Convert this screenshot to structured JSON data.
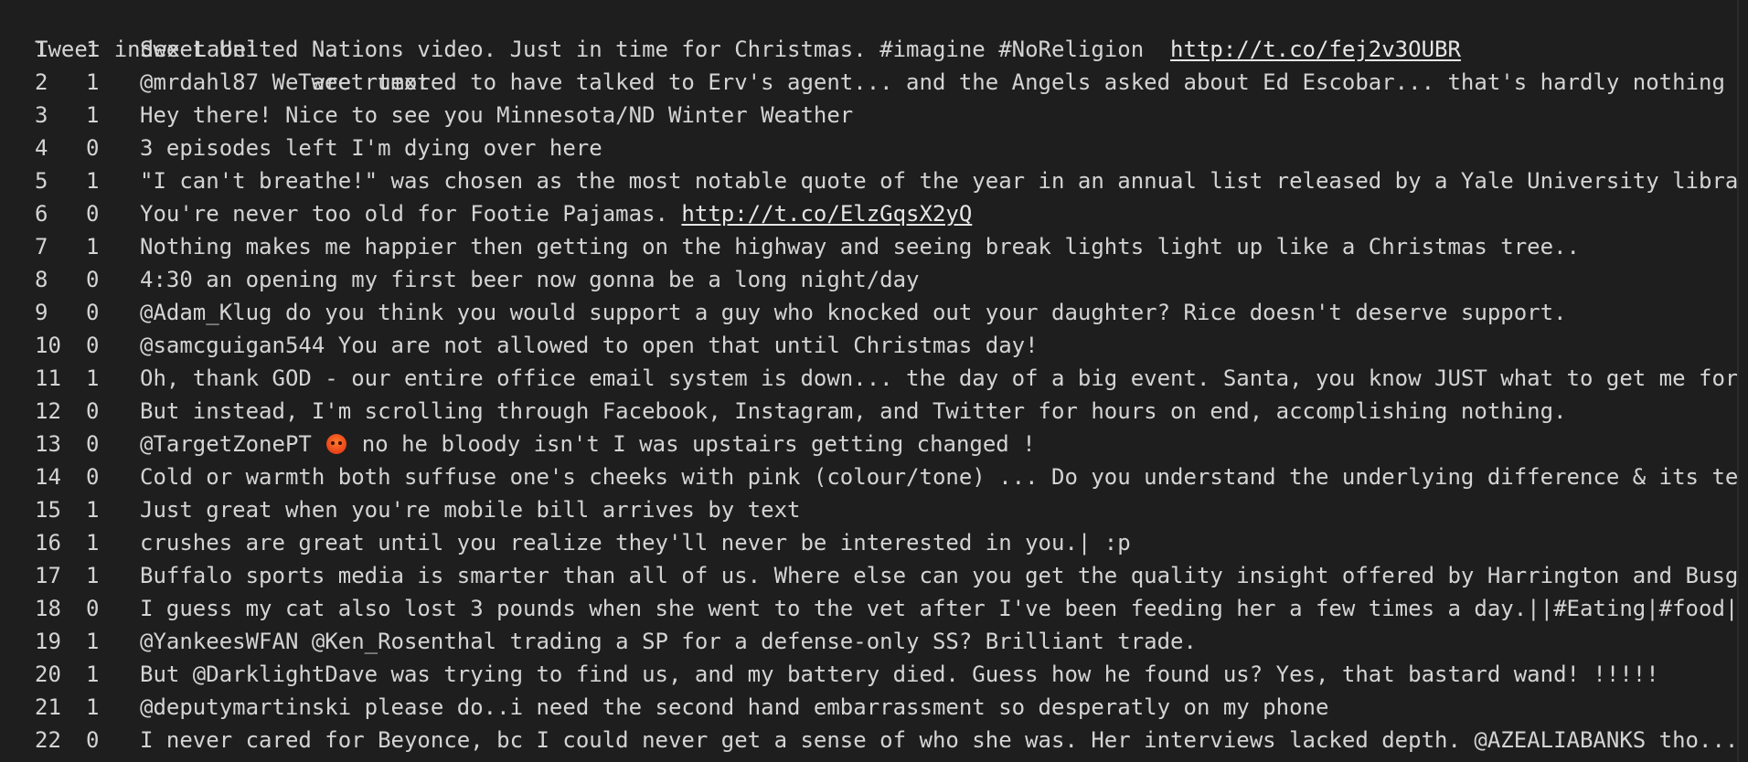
{
  "header": {
    "col1": "Tweet index Label",
    "col2": "Tweet text"
  },
  "rows": [
    {
      "index": "1",
      "label": "1",
      "text": "Sweet United Nations video. Just in time for Christmas. #imagine #NoReligion  ",
      "link": "http://t.co/fej2v3OUBR"
    },
    {
      "index": "2",
      "label": "1",
      "text": "@mrdahl87 We are rumored to have talked to Erv's agent... and the Angels asked about Ed Escobar... that's hardly nothing ;)"
    },
    {
      "index": "3",
      "label": "1",
      "text": "Hey there! Nice to see you Minnesota/ND Winter Weather"
    },
    {
      "index": "4",
      "label": "0",
      "text": "3 episodes left I'm dying over here"
    },
    {
      "index": "5",
      "label": "1",
      "text": "\"I can't breathe!\" was chosen as the most notable quote of the year in an annual list released by a Yale University librarian"
    },
    {
      "index": "6",
      "label": "0",
      "text": "You're never too old for Footie Pajamas. ",
      "link": "http://t.co/ElzGqsX2yQ"
    },
    {
      "index": "7",
      "label": "1",
      "text": "Nothing makes me happier then getting on the highway and seeing break lights light up like a Christmas tree.."
    },
    {
      "index": "8",
      "label": "0",
      "text": "4:30 an opening my first beer now gonna be a long night/day"
    },
    {
      "index": "9",
      "label": "0",
      "text": "@Adam_Klug do you think you would support a guy who knocked out your daughter? Rice doesn't deserve support."
    },
    {
      "index": "10",
      "label": "0",
      "text": "@samcguigan544 You are not allowed to open that until Christmas day!"
    },
    {
      "index": "11",
      "label": "1",
      "text": "Oh, thank GOD - our entire office email system is down... the day of a big event. Santa, you know JUST what to get me for"
    },
    {
      "index": "12",
      "label": "0",
      "text": "But instead, I'm scrolling through Facebook, Instagram, and Twitter for hours on end, accomplishing nothing."
    },
    {
      "index": "13",
      "label": "0",
      "text": "@TargetZonePT ",
      "emoji": "angry-face-icon",
      "text_after": " no he bloody isn't I was upstairs getting changed !"
    },
    {
      "index": "14",
      "label": "0",
      "text": "Cold or warmth both suffuse one's cheeks with pink (colour/tone) ... Do you understand the underlying difference & its te"
    },
    {
      "index": "15",
      "label": "1",
      "text": "Just great when you're mobile bill arrives by text"
    },
    {
      "index": "16",
      "label": "1",
      "text": "crushes are great until you realize they'll never be interested in you.| :p"
    },
    {
      "index": "17",
      "label": "1",
      "text": "Buffalo sports media is smarter than all of us. Where else can you get the quality insight offered by Harrington and Busg"
    },
    {
      "index": "18",
      "label": "0",
      "text": "I guess my cat also lost 3 pounds when she went to the vet after I've been feeding her a few times a day.||#Eating|#food|"
    },
    {
      "index": "19",
      "label": "1",
      "text": "@YankeesWFAN @Ken_Rosenthal trading a SP for a defense-only SS? Brilliant trade."
    },
    {
      "index": "20",
      "label": "1",
      "text": "But @DarklightDave was trying to find us, and my battery died. Guess how he found us? Yes, that bastard wand! !!!!!"
    },
    {
      "index": "21",
      "label": "1",
      "text": "@deputymartinski please do..i need the second hand embarrassment so desperatly on my phone"
    },
    {
      "index": "22",
      "label": "0",
      "text": "I never cared for Beyonce, bc I could never get a sense of who she was. Her interviews lacked depth. @AZEALIABANKS tho..."
    }
  ]
}
